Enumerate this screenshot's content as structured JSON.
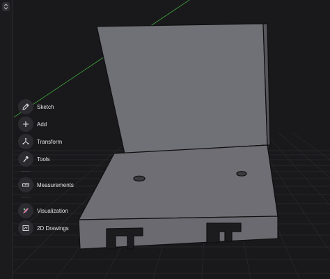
{
  "toolbar": {
    "items": [
      {
        "label": "Sketch",
        "icon": "pencil-icon"
      },
      {
        "label": "Add",
        "icon": "plus-icon"
      },
      {
        "label": "Transform",
        "icon": "transform-axes-icon"
      },
      {
        "label": "Tools",
        "icon": "hammer-icon"
      },
      {
        "label": "Measurements",
        "icon": "ruler-icon"
      },
      {
        "label": "Visualization",
        "icon": "palette-icon"
      },
      {
        "label": "2D Drawings",
        "icon": "drawing-sheet-icon"
      }
    ]
  },
  "viewport": {
    "model": "l-bracket",
    "background": "#19191b",
    "grid_color": "#2b2b2f",
    "axis_color": "#3d9a3d",
    "model_color": "#6e6e74"
  }
}
